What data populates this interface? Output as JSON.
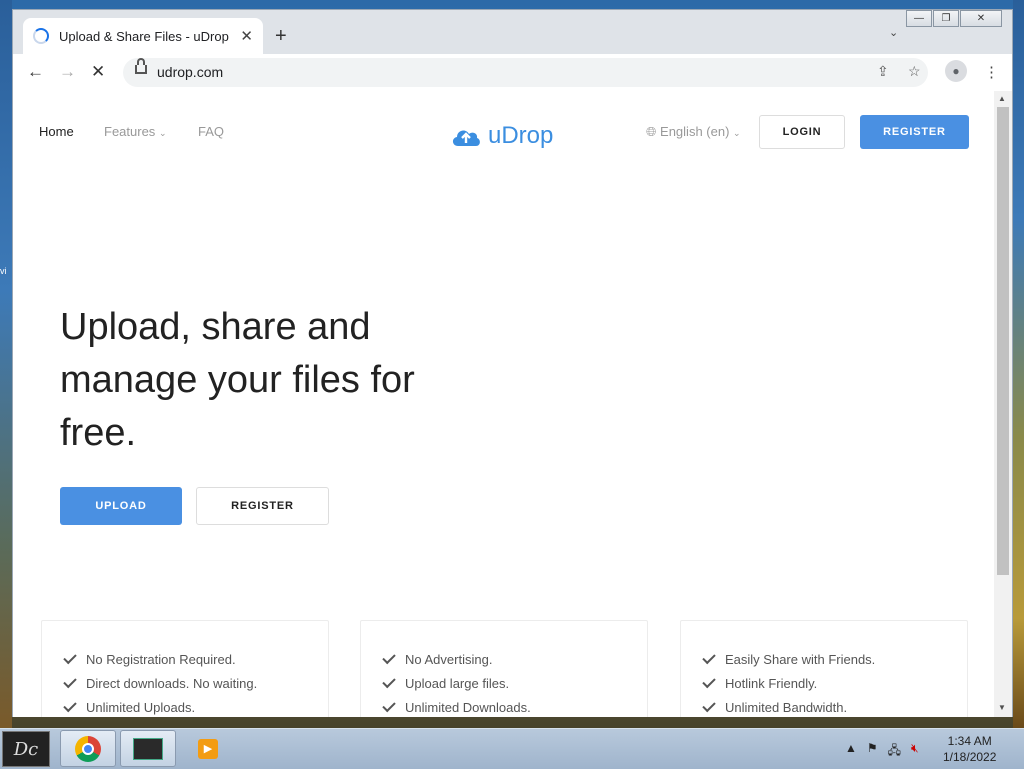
{
  "browser": {
    "tab_title": "Upload & Share Files - uDrop",
    "url": "udrop.com"
  },
  "site": {
    "nav": {
      "home": "Home",
      "features": "Features",
      "faq": "FAQ"
    },
    "logo_text": "uDrop",
    "language": "English (en)",
    "login_label": "LOGIN",
    "register_label": "REGISTER"
  },
  "hero": {
    "heading": "Upload, share and manage your files for free.",
    "upload_label": "UPLOAD",
    "register_label": "REGISTER"
  },
  "features": [
    {
      "items": [
        "No Registration Required.",
        "Direct downloads. No waiting.",
        "Unlimited Uploads."
      ]
    },
    {
      "items": [
        "No Advertising.",
        "Upload large files.",
        "Unlimited Downloads."
      ]
    },
    {
      "items": [
        "Easily Share with Friends.",
        "Hotlink Friendly.",
        "Unlimited Bandwidth."
      ]
    }
  ],
  "taskbar": {
    "time": "1:34 AM",
    "date": "1/18/2022",
    "start_label": "Dc"
  },
  "desktop": {
    "stub_text": "vi"
  },
  "colors": {
    "accent": "#4a90e2",
    "logo": "#3b8ee0"
  }
}
